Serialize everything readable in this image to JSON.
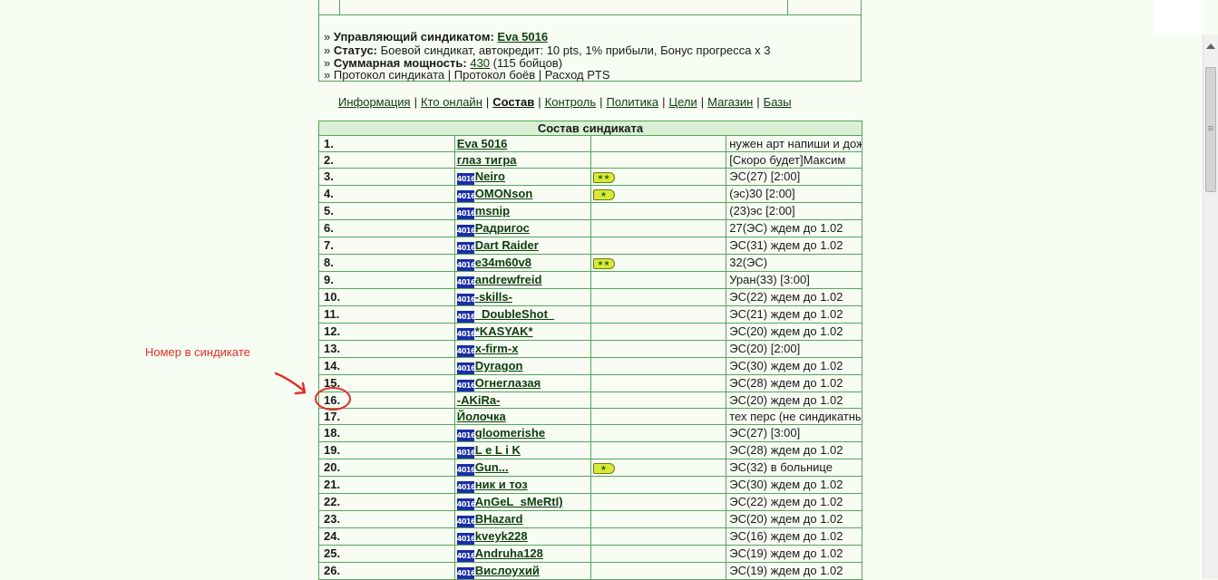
{
  "info": {
    "manager_label": "Управляющий синдикатом:",
    "manager_value": "Eva 5016",
    "status_label": "Статус:",
    "status_value": "Боевой синдикат, автокредит: 10 pts, 1% прибыли, Бонус прогресса x 3",
    "power_label": "Суммарная мощность:",
    "power_value": "430",
    "power_suffix": "(115 бойцов)",
    "log_synd": "Протокол синдиката",
    "log_battles": "Протокол боёв",
    "pts_expense": "Расход PTS",
    "sep": "|",
    "bullet": "»"
  },
  "nav": {
    "items": [
      "Информация",
      "Кто онлайн",
      "Состав",
      "Контроль",
      "Политика",
      "Цели",
      "Магазин",
      "Базы"
    ],
    "current": "Состав",
    "sep": "|"
  },
  "roster": {
    "title": "Состав синдиката",
    "clan_tag": "4016",
    "rows": [
      {
        "num": "1.",
        "name": "Eva 5016",
        "clan": false,
        "badge": "",
        "status": "нужен арт напиши и дождись ответа"
      },
      {
        "num": "2.",
        "name": "глаз тигра",
        "clan": false,
        "badge": "",
        "status": "[Скоро будет]Максим"
      },
      {
        "num": "3.",
        "name": "Neiro",
        "clan": true,
        "badge": "★★",
        "status": "ЭС(27) [2:00]"
      },
      {
        "num": "4.",
        "name": "OMONson",
        "clan": true,
        "badge": "★",
        "status": "(эс)30 [2:00]"
      },
      {
        "num": "5.",
        "name": "msnip",
        "clan": true,
        "badge": "",
        "status": "(23)эс [2:00]"
      },
      {
        "num": "6.",
        "name": "Радригос",
        "clan": true,
        "badge": "",
        "status": "27(ЭС) ждем до 1.02"
      },
      {
        "num": "7.",
        "name": "Dart Raider",
        "clan": true,
        "badge": "",
        "status": "ЭС(31) ждем до 1.02"
      },
      {
        "num": "8.",
        "name": "e34m60v8",
        "clan": true,
        "badge": "★★",
        "status": "32(ЭС)"
      },
      {
        "num": "9.",
        "name": "andrewfreid",
        "clan": true,
        "badge": "",
        "status": "Уран(33) [3:00]"
      },
      {
        "num": "10.",
        "name": "-skills-",
        "clan": true,
        "badge": "",
        "status": "ЭС(22) ждем до 1.02"
      },
      {
        "num": "11.",
        "name": "_DoubleShot_",
        "clan": true,
        "badge": "",
        "status": "ЭС(21) ждем до 1.02"
      },
      {
        "num": "12.",
        "name": "*KASYAK*",
        "clan": true,
        "badge": "",
        "status": "ЭС(20) ждем до 1.02"
      },
      {
        "num": "13.",
        "name": "x-firm-x",
        "clan": true,
        "badge": "",
        "status": "ЭС(20) [2:00]"
      },
      {
        "num": "14.",
        "name": "Dyragon",
        "clan": true,
        "badge": "",
        "status": "ЭС(30) ждем до 1.02"
      },
      {
        "num": "15.",
        "name": "Огнеглазая",
        "clan": true,
        "badge": "",
        "status": "ЭС(28) ждем до 1.02"
      },
      {
        "num": "16.",
        "name": "-AKiRa-",
        "clan": false,
        "badge": "",
        "status": "ЭС(20) ждем до 1.02"
      },
      {
        "num": "17.",
        "name": "Йолочка",
        "clan": false,
        "badge": "",
        "status": "тех перс (не синдикатный)"
      },
      {
        "num": "18.",
        "name": "gloomerishe",
        "clan": true,
        "badge": "",
        "status": "ЭС(27) [3:00]"
      },
      {
        "num": "19.",
        "name": "L e L i K",
        "clan": true,
        "badge": "",
        "status": "ЭС(28) ждем до 1.02"
      },
      {
        "num": "20.",
        "name": "Gun...",
        "clan": true,
        "badge": "★",
        "status": "ЭС(32) в больнице"
      },
      {
        "num": "21.",
        "name": "ник и тоз",
        "clan": true,
        "badge": "",
        "status": "ЭС(30) ждем до 1.02"
      },
      {
        "num": "22.",
        "name": "AnGeL_sMeRtI)",
        "clan": true,
        "badge": "",
        "status": "ЭС(22) ждем до 1.02"
      },
      {
        "num": "23.",
        "name": "BHazard",
        "clan": true,
        "badge": "",
        "status": "ЭС(20) ждем до 1.02"
      },
      {
        "num": "24.",
        "name": "kveyk228",
        "clan": true,
        "badge": "",
        "status": "ЭС(16) ждем до 1.02"
      },
      {
        "num": "25.",
        "name": "Andruha128",
        "clan": true,
        "badge": "",
        "status": "ЭС(19) ждем до 1.02"
      },
      {
        "num": "26.",
        "name": "Вислоухий",
        "clan": true,
        "badge": "",
        "status": "ЭС(19) ждем до 1.02"
      }
    ]
  },
  "annotation": {
    "text": "Номер в синдикате",
    "color": "#e0302a"
  },
  "icons": {
    "clan": "clan-emblem-icon",
    "badge": "star-badge-icon",
    "scroll_up": "scroll-up-arrow-icon",
    "arrow": "red-arrow-icon",
    "circle": "red-circle-highlight"
  }
}
